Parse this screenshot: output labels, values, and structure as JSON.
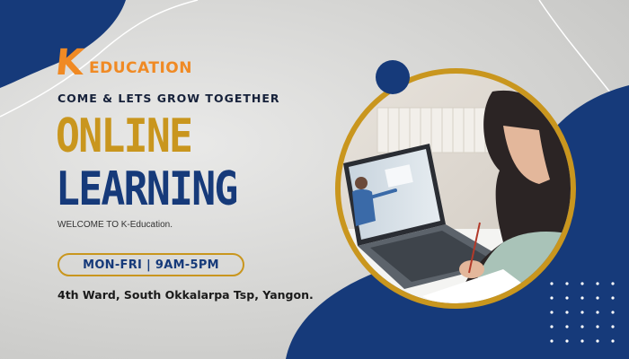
{
  "brand": {
    "logo_letter": "K",
    "logo_word": "EDUCATION"
  },
  "tagline": "COME & LETS GROW TOGETHER",
  "title": {
    "line1": "ONLINE",
    "line2": "LEARNING"
  },
  "welcome": "WELCOME TO K-Education.",
  "hours": "MON-FRI | 9AM-5PM",
  "address": "4th Ward, South Okkalarpa Tsp, Yangon.",
  "colors": {
    "navy": "#163a7a",
    "gold": "#c9961e",
    "orange": "#f08a24"
  },
  "photo": {
    "subject": "student watching online lecture on laptop"
  }
}
